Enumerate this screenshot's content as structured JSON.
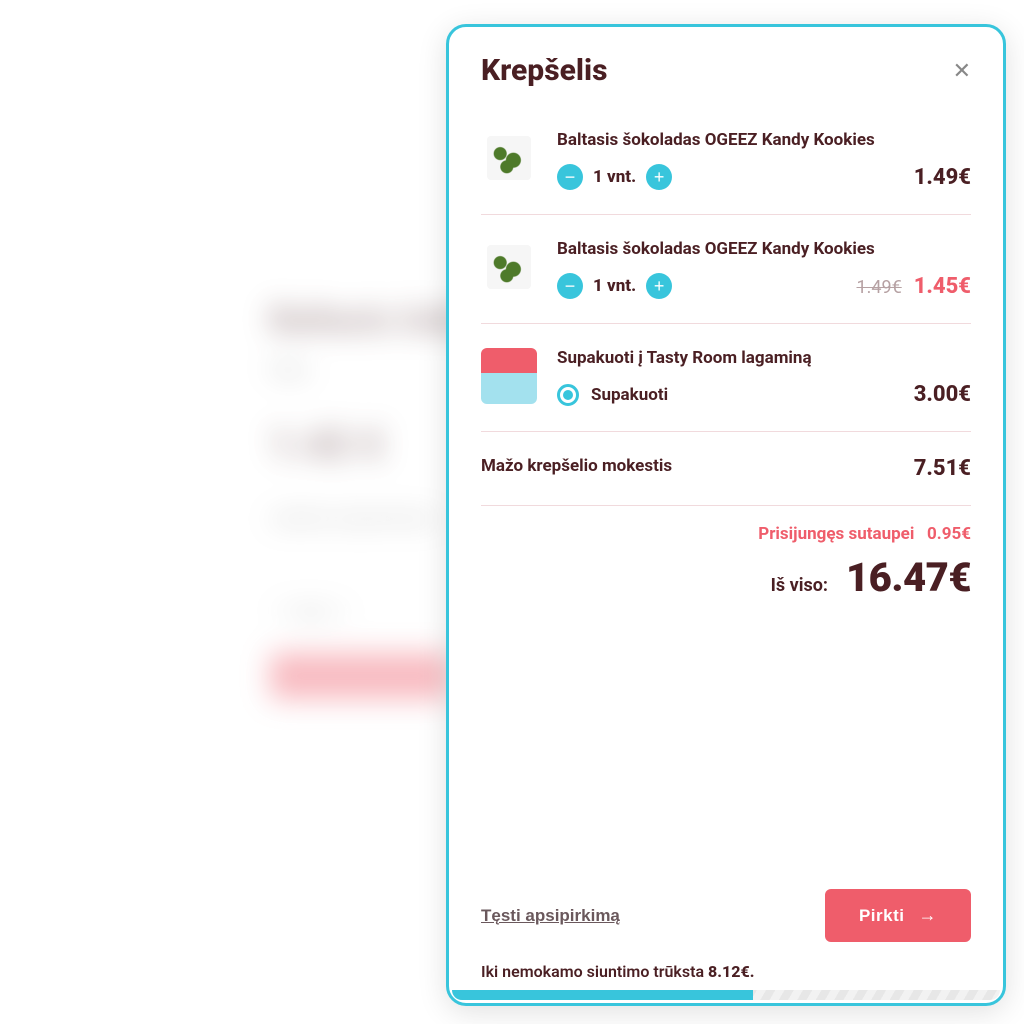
{
  "drawer": {
    "title": "Krepšelis"
  },
  "items": [
    {
      "name": "Baltasis šokoladas OGEEZ Kandy Kookies",
      "qty_label": "1 vnt.",
      "price": "1.49€"
    },
    {
      "name": "Baltasis šokoladas OGEEZ Kandy Kookies",
      "qty_label": "1 vnt.",
      "old_price": "1.49€",
      "price": "1.45€"
    }
  ],
  "packaging": {
    "title": "Supakuoti į Tasty Room lagaminą",
    "option_label": "Supakuoti",
    "price": "3.00€"
  },
  "fee": {
    "label": "Mažo krepšelio mokestis",
    "price": "7.51€"
  },
  "summary": {
    "saved_label": "Prisijungęs sutaupei",
    "saved_value": "0.95€",
    "total_label": "Iš viso:",
    "total_value": "16.47€"
  },
  "footer": {
    "continue": "Tęsti apsipirkimą",
    "buy": "Pirkti",
    "ship_prefix": "Iki nemokamo siuntimo trūksta ",
    "ship_amount": "8.12€."
  },
  "colors": {
    "accent": "#38c5dc",
    "danger": "#ef5d6b"
  }
}
